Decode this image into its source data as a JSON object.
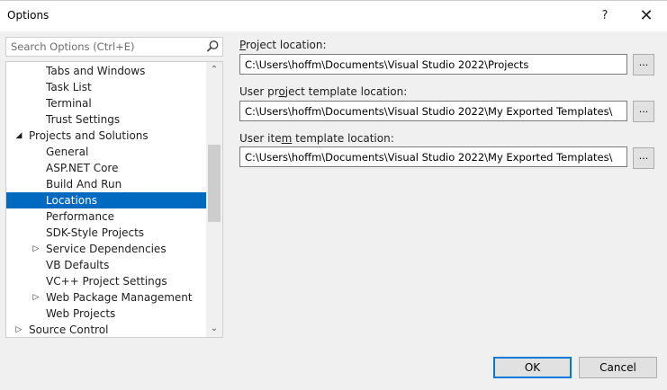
{
  "window": {
    "title": "Options",
    "help_glyph": "?",
    "close_glyph": "✕"
  },
  "search": {
    "placeholder": "Search Options (Ctrl+E)"
  },
  "tree": {
    "items": [
      {
        "label": "Tabs and Windows",
        "level": 2,
        "arrow": "",
        "selected": false
      },
      {
        "label": "Task List",
        "level": 2,
        "arrow": "",
        "selected": false
      },
      {
        "label": "Terminal",
        "level": 2,
        "arrow": "",
        "selected": false
      },
      {
        "label": "Trust Settings",
        "level": 2,
        "arrow": "",
        "selected": false
      },
      {
        "label": "Projects and Solutions",
        "level": 1,
        "arrow": "◢",
        "selected": false
      },
      {
        "label": "General",
        "level": 2,
        "arrow": "",
        "selected": false
      },
      {
        "label": "ASP.NET Core",
        "level": 2,
        "arrow": "",
        "selected": false
      },
      {
        "label": "Build And Run",
        "level": 2,
        "arrow": "",
        "selected": false
      },
      {
        "label": "Locations",
        "level": 2,
        "arrow": "",
        "selected": true
      },
      {
        "label": "Performance",
        "level": 2,
        "arrow": "",
        "selected": false
      },
      {
        "label": "SDK-Style Projects",
        "level": 2,
        "arrow": "",
        "selected": false
      },
      {
        "label": "Service Dependencies",
        "level": 2,
        "arrow": "▷",
        "selected": false
      },
      {
        "label": "VB Defaults",
        "level": 2,
        "arrow": "",
        "selected": false
      },
      {
        "label": "VC++ Project Settings",
        "level": 2,
        "arrow": "",
        "selected": false
      },
      {
        "label": "Web Package Management",
        "level": 2,
        "arrow": "▷",
        "selected": false
      },
      {
        "label": "Web Projects",
        "level": 2,
        "arrow": "",
        "selected": false
      },
      {
        "label": "Source Control",
        "level": 1,
        "arrow": "▷",
        "selected": false
      }
    ],
    "scroll_up_glyph": "⌃",
    "scroll_down_glyph": "⌄"
  },
  "fields": {
    "project": {
      "label_pre": "",
      "label_accel": "P",
      "label_post": "roject location:",
      "value": "C:\\Users\\hoffm\\Documents\\Visual Studio 2022\\Projects",
      "browse_label": "..."
    },
    "user_project_template": {
      "label_pre": "User pr",
      "label_accel": "o",
      "label_post": "ject template location:",
      "value": "C:\\Users\\hoffm\\Documents\\Visual Studio 2022\\My Exported Templates\\",
      "browse_label": "..."
    },
    "user_item_template": {
      "label_pre": "User ite",
      "label_accel": "m",
      "label_post": " template location:",
      "value": "C:\\Users\\hoffm\\Documents\\Visual Studio 2022\\My Exported Templates\\",
      "browse_label": "..."
    }
  },
  "footer": {
    "ok_label": "OK",
    "cancel_label": "Cancel"
  },
  "colors": {
    "selection": "#0069c0",
    "ok_border": "#0078d7",
    "dialog_bg": "#f0f0f0"
  }
}
